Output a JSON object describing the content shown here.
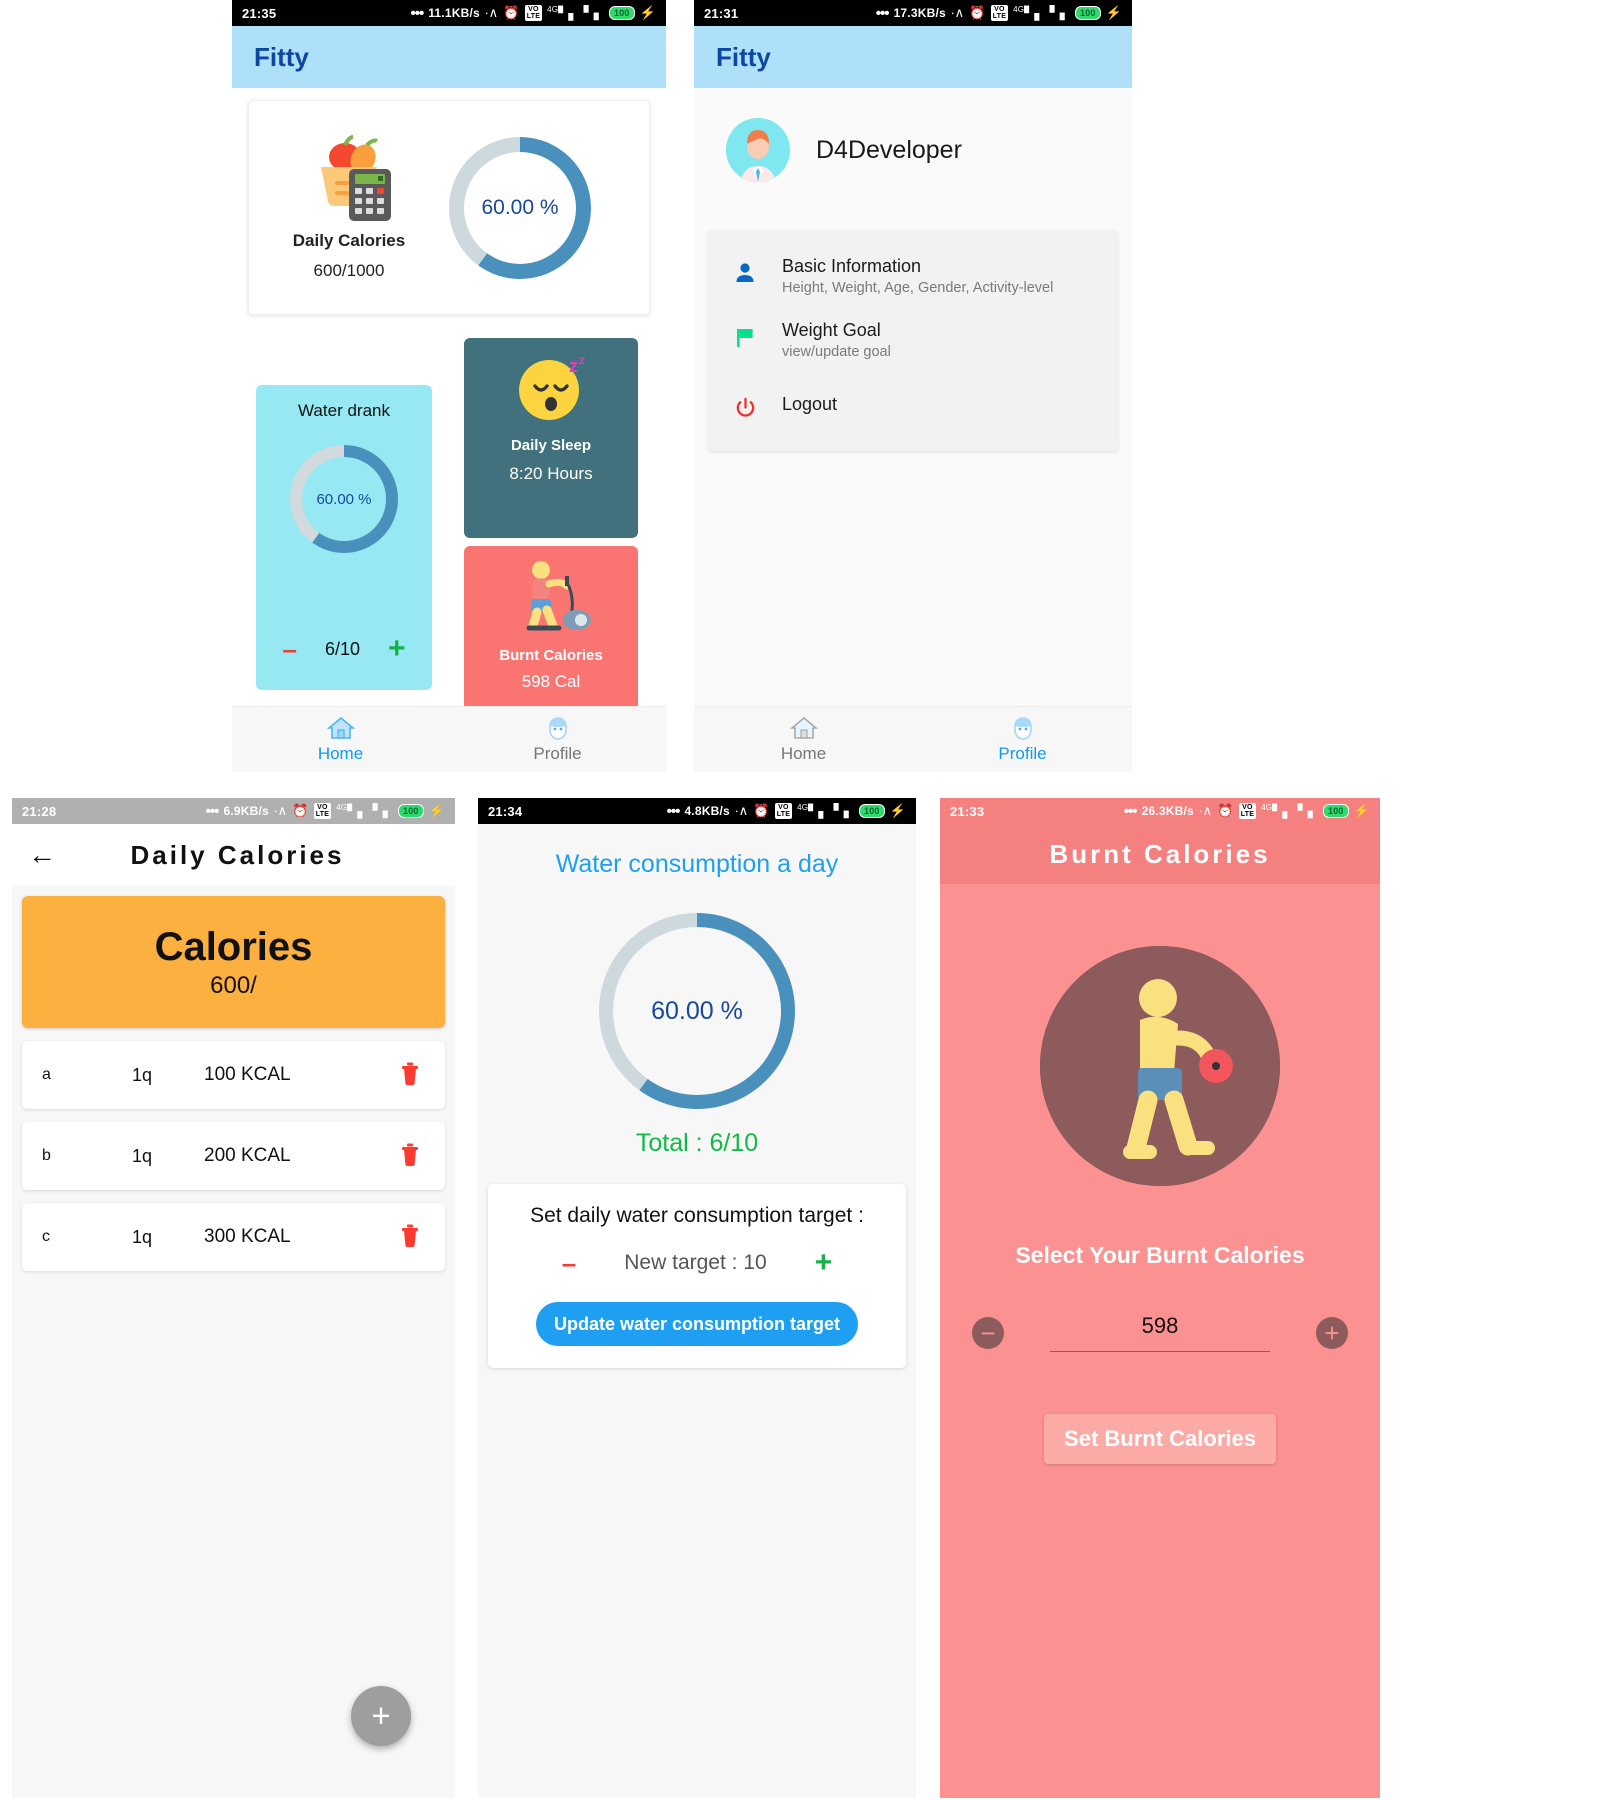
{
  "screens": {
    "home": {
      "status": {
        "time": "21:35",
        "net": "11.1KB/s",
        "battery": "100"
      },
      "appbar_title": "Fitty",
      "calories": {
        "icon": "vegetables-calculator-icon",
        "title": "Daily Calories",
        "value": "600/1000",
        "percent_label": "60.00 %",
        "percent": 60
      },
      "water": {
        "title": "Water drank",
        "percent_label": "60.00 %",
        "percent": 60,
        "count": "6/10",
        "minus": "–",
        "plus": "+"
      },
      "sleep": {
        "icon": "sleeping-face-icon",
        "title": "Daily Sleep",
        "value": "8:20 Hours"
      },
      "burnt": {
        "icon": "exercise-bike-icon",
        "title": "Burnt Calories",
        "value": "598 Cal"
      },
      "nav": [
        {
          "label": "Home",
          "icon": "home-icon",
          "active": true
        },
        {
          "label": "Profile",
          "icon": "profile-icon",
          "active": false
        }
      ]
    },
    "profile": {
      "status": {
        "time": "21:31",
        "net": "17.3KB/s",
        "battery": "100"
      },
      "appbar_title": "Fitty",
      "avatar": "user-avatar",
      "username": "D4Developer",
      "menu": [
        {
          "icon": "person-icon",
          "title": "Basic Information",
          "sub": "Height, Weight, Age, Gender, Activity-level"
        },
        {
          "icon": "flag-icon",
          "title": "Weight Goal",
          "sub": "view/update goal"
        },
        {
          "icon": "power-icon",
          "title": "Logout",
          "sub": ""
        }
      ],
      "nav": [
        {
          "label": "Home",
          "icon": "home-icon",
          "active": false
        },
        {
          "label": "Profile",
          "icon": "profile-icon",
          "active": true
        }
      ]
    },
    "daily_calories": {
      "status": {
        "time": "21:28",
        "net": "6.9KB/s",
        "battery": "100"
      },
      "back": "←",
      "title": "Daily Calories",
      "banner": {
        "title": "Calories",
        "value": "600/"
      },
      "rows": [
        {
          "name": "a",
          "qty": "1q",
          "kcal": "100 KCAL",
          "delete": "trash-icon"
        },
        {
          "name": "b",
          "qty": "1q",
          "kcal": "200 KCAL",
          "delete": "trash-icon"
        },
        {
          "name": "c",
          "qty": "1q",
          "kcal": "300 KCAL",
          "delete": "trash-icon"
        }
      ],
      "fab": "+"
    },
    "water": {
      "status": {
        "time": "21:34",
        "net": "4.8KB/s",
        "battery": "100"
      },
      "title": "Water consumption  a day",
      "percent_label": "60.00 %",
      "percent": 60,
      "total": "Total : 6/10",
      "card_title": "Set daily water consumption target :",
      "minus": "–",
      "plus": "+",
      "new_target": "New target : 10",
      "update_button": "Update water consumption target"
    },
    "burnt": {
      "status": {
        "time": "21:33",
        "net": "26.3KB/s",
        "battery": "100"
      },
      "title": "Burnt Calories",
      "icon": "walking-person-icon",
      "select_label": "Select Your Burnt Calories",
      "minus": "−",
      "plus": "+",
      "value": "598",
      "button": "Set Burnt Calories"
    }
  },
  "colors": {
    "app_bar": "#aee0f9",
    "brand_blue": "#0d47a1",
    "donut_fill": "#4a90bd",
    "donut_track": "#ced9de",
    "water_card": "#96e9f2",
    "sleep_card": "#41717c",
    "burnt_card": "#fa7571",
    "calories_banner": "#fbb03f",
    "accent_blue": "#1e9ff2",
    "green": "#10bb45",
    "red": "#ef3e36",
    "burnt_bg": "#fb9191"
  }
}
